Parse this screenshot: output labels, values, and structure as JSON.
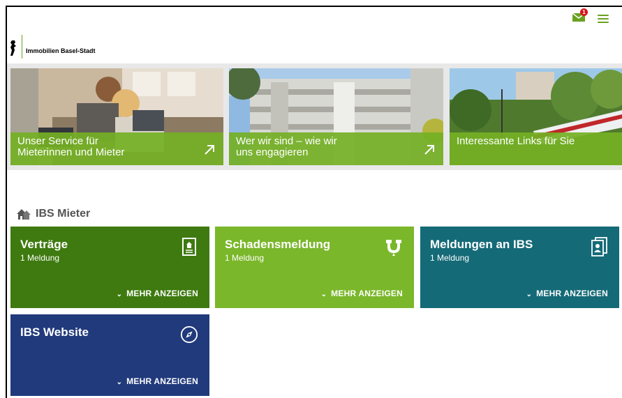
{
  "header": {
    "mail_badge_count": "1",
    "logo_text": "Immobilien Basel-Stadt"
  },
  "hero_cards": [
    {
      "label": "Unser Service für Mieterinnen und Mieter",
      "line1": "Unser Service für",
      "line2": "Mieterinnen und Mieter"
    },
    {
      "label": "Wer wir sind – wie wir uns engagieren",
      "line1": "Wer wir sind – wie wir",
      "line2": "uns engagieren"
    },
    {
      "label": "Interessante Links für Sie",
      "line1": "Interessante Links für Sie",
      "line2": ""
    }
  ],
  "section": {
    "title": "IBS Mieter"
  },
  "tiles": [
    {
      "title": "Verträge",
      "sub": "1 Meldung",
      "more": "MEHR ANZEIGEN",
      "color": "#3e7a0f"
    },
    {
      "title": "Schadensmeldung",
      "sub": "1 Meldung",
      "more": "MEHR ANZEIGEN",
      "color": "#7ab72a"
    },
    {
      "title": "Meldungen an IBS",
      "sub": "1 Meldung",
      "more": "MEHR ANZEIGEN",
      "color": "#156a77"
    },
    {
      "title": "IBS Website",
      "sub": "",
      "more": "MEHR ANZEIGEN",
      "color": "#213a7c"
    }
  ],
  "colors": {
    "accent": "#6aa11e"
  }
}
